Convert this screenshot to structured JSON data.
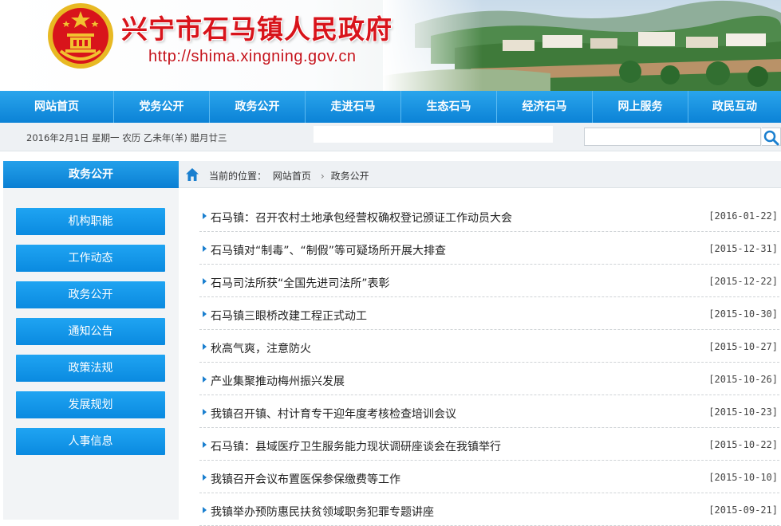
{
  "header": {
    "title": "兴宁市石马镇人民政府",
    "url": "http://shima.xingning.gov.cn"
  },
  "nav": {
    "items": [
      "网站首页",
      "党务公开",
      "政务公开",
      "走进石马",
      "生态石马",
      "经济石马",
      "网上服务",
      "政民互动"
    ]
  },
  "datebar": {
    "date": "2016年2月1日  星期一  农历 乙未年(羊) 腊月廿三",
    "search_placeholder": ""
  },
  "sidebar": {
    "heading": "政务公开",
    "items": [
      "机构职能",
      "工作动态",
      "政务公开",
      "通知公告",
      "政策法规",
      "发展规划",
      "人事信息"
    ]
  },
  "breadcrumb": {
    "label": "当前的位置：",
    "home": "网站首页",
    "current": "政务公开"
  },
  "articles": [
    {
      "title": "石马镇：召开农村土地承包经营权确权登记颁证工作动员大会",
      "date": "[2016-01-22]"
    },
    {
      "title": "石马镇对“制毒”、“制假”等可疑场所开展大排查",
      "date": "[2015-12-31]"
    },
    {
      "title": "石马司法所获“全国先进司法所”表彰",
      "date": "[2015-12-22]"
    },
    {
      "title": "石马镇三眼桥改建工程正式动工",
      "date": "[2015-10-30]"
    },
    {
      "title": "秋高气爽，注意防火",
      "date": "[2015-10-27]"
    },
    {
      "title": "产业集聚推动梅州振兴发展",
      "date": "[2015-10-26]"
    },
    {
      "title": "我镇召开镇、村计育专干迎年度考核检查培训会议",
      "date": "[2015-10-23]"
    },
    {
      "title": "石马镇：县域医疗卫生服务能力现状调研座谈会在我镇举行",
      "date": "[2015-10-22]"
    },
    {
      "title": "我镇召开会议布置医保参保缴费等工作",
      "date": "[2015-10-10]"
    },
    {
      "title": "我镇举办预防惠民扶贫领域职务犯罪专题讲座",
      "date": "[2015-09-21]"
    }
  ],
  "colors": {
    "nav_blue": "#0b82d6",
    "title_red": "#d8141b",
    "bullet_blue": "#1a7fcf"
  },
  "icons": {
    "emblem": "national-emblem-icon",
    "home": "home-icon",
    "search": "search-icon",
    "bullet": "triangle-bullet-icon"
  }
}
